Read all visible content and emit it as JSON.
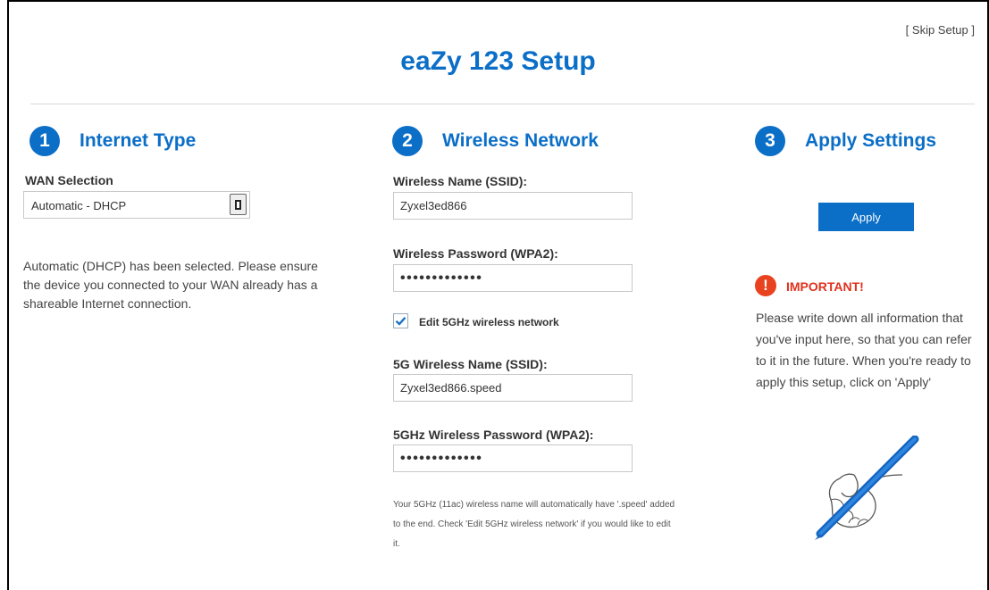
{
  "header": {
    "skip_link": "[ Skip Setup ]",
    "title": "eaZy 123 Setup"
  },
  "steps": [
    {
      "number": "1",
      "label": "Internet Type"
    },
    {
      "number": "2",
      "label": "Wireless Network"
    },
    {
      "number": "3",
      "label": "Apply Settings"
    }
  ],
  "internet": {
    "wan_label": "WAN Selection",
    "wan_value": "Automatic - DHCP",
    "description": "Automatic (DHCP) has been selected. Please ensure the device you connected to your WAN already has a shareable Internet connection."
  },
  "wireless": {
    "ssid_label": "Wireless Name (SSID):",
    "ssid_value": "Zyxel3ed866",
    "password_label": "Wireless Password (WPA2):",
    "password_value": "•••••••••••••",
    "edit5g_label": "Edit 5GHz wireless network",
    "edit5g_checked": true,
    "ssid5g_label": "5G Wireless Name (SSID):",
    "ssid5g_value": "Zyxel3ed866.speed",
    "password5g_label": "5GHz Wireless Password (WPA2):",
    "password5g_value": "•••••••••••••",
    "note": "Your 5GHz (11ac) wireless name will automatically have '.speed' added to the end. Check 'Edit 5GHz wireless network' if you would like to edit it."
  },
  "apply": {
    "button_label": "Apply",
    "important_icon": "exclamation-icon",
    "important_title": "IMPORTANT!",
    "important_text": "Please write down all information that you've input here, so that you can refer to it in the future. When you're ready to apply this setup, click on 'Apply'",
    "illustration_icon": "hand-pen-icon"
  },
  "colors": {
    "brand_blue": "#0b6ec7",
    "warning_red": "#e0311d"
  }
}
